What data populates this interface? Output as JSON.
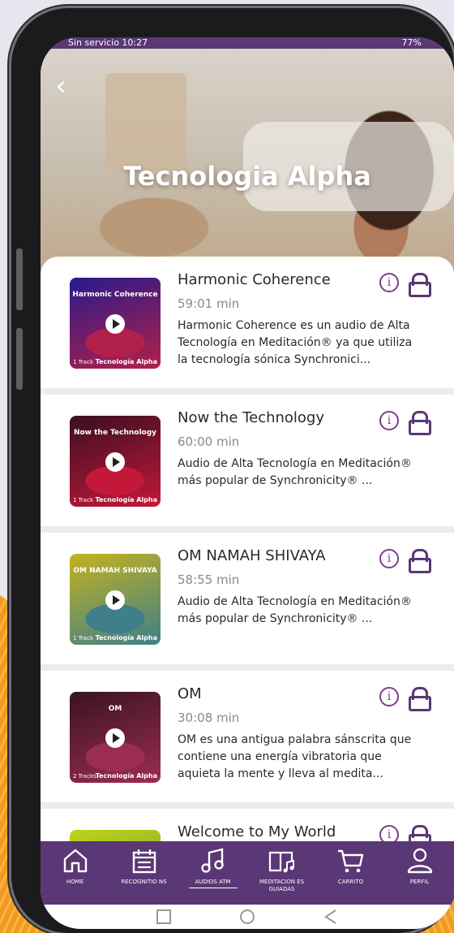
{
  "status_bar": {
    "left": "Sin servicio 10:27",
    "right": "77%"
  },
  "header": {
    "back_label": "‹",
    "title": "Tecnologia Alpha"
  },
  "items": [
    {
      "title": "Harmonic Coherence",
      "duration": "59:01 min",
      "description": "Harmonic Coherence es un audio de Alta Tecnología en Meditación® ya que utiliza la tecnología sónica Synchronici...",
      "thumb_label": "Harmonic Coherence",
      "thumb_tracks": "1 Track",
      "thumb_brand": "Tecnología Alpha",
      "thumb_colors": [
        "#2a1a8a",
        "#b1204a"
      ]
    },
    {
      "title": "Now the Technology",
      "duration": "60:00 min",
      "description": "Audio de Alta Tecnología en Meditación® más popular de Synchronicity® ...",
      "thumb_label": "Now the Technology",
      "thumb_tracks": "1 Track",
      "thumb_brand": "Tecnología Alpha",
      "thumb_colors": [
        "#3a0f20",
        "#c4183a"
      ]
    },
    {
      "title": "OM NAMAH SHIVAYA",
      "duration": "58:55 min",
      "description": "Audio de Alta Tecnología en Meditación® más popular de Synchronicity® ...",
      "thumb_label": "OM NAMAH SHIVAYA",
      "thumb_tracks": "1 Track",
      "thumb_brand": "Tecnología Alpha",
      "thumb_colors": [
        "#c4b21e",
        "#3f7f8a"
      ]
    },
    {
      "title": "OM",
      "duration": "30:08 min",
      "description": "OM es una antigua palabra sánscrita que contiene una energía vibratoria que aquieta la mente y lleva al medita...",
      "thumb_label": "OM",
      "thumb_tracks": "2 Tracks",
      "thumb_brand": "Tecnología Alpha",
      "thumb_colors": [
        "#3a1420",
        "#9b2c52"
      ]
    },
    {
      "title": "Welcome to My World",
      "duration": "",
      "description": "",
      "thumb_label": "",
      "thumb_tracks": "",
      "thumb_brand": "",
      "thumb_colors": [
        "#bfd21e",
        "#6a9a2a"
      ]
    }
  ],
  "nav": [
    {
      "label": "HOME",
      "icon": "home-icon"
    },
    {
      "label": "RECOGNITIO NS",
      "icon": "calendar-icon"
    },
    {
      "label": "AUDIOS ATM",
      "icon": "music-note-icon",
      "active": true
    },
    {
      "label": "MEDITACION ES GUIADAS",
      "icon": "book-music-icon"
    },
    {
      "label": "CARRITO",
      "icon": "cart-icon"
    },
    {
      "label": "PERFIL",
      "icon": "user-icon"
    }
  ],
  "colors": {
    "brand": "#5a3775",
    "accent": "#7b3d88"
  }
}
